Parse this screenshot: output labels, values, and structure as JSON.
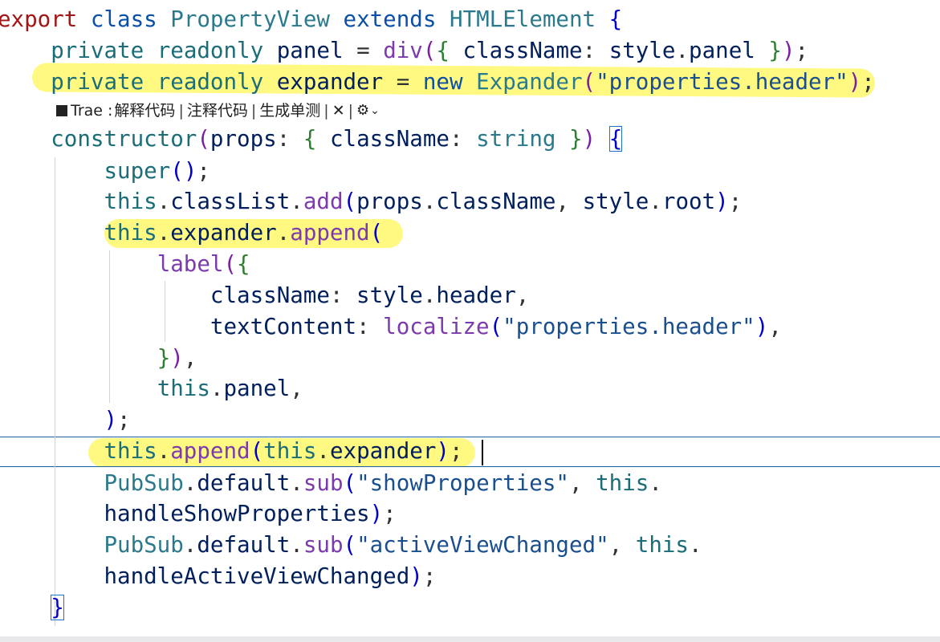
{
  "codelens": {
    "brand": "Trae",
    "actions": [
      "解释代码",
      "注释代码",
      "生成单测"
    ],
    "separator": "|",
    "close_glyph": "✕",
    "settings_icon": "gear-icon",
    "chevron_icon": "chevron-down-icon"
  },
  "code": [
    {
      "tokens": [
        {
          "t": "export",
          "c": "k-red"
        },
        {
          "t": " "
        },
        {
          "t": "class",
          "c": "k-blue"
        },
        {
          "t": " "
        },
        {
          "t": "PropertyView",
          "c": "k-type"
        },
        {
          "t": " "
        },
        {
          "t": "extends",
          "c": "k-blue"
        },
        {
          "t": " "
        },
        {
          "t": "HTMLElement",
          "c": "k-type"
        },
        {
          "t": " "
        },
        {
          "t": "{",
          "c": "k-br1"
        }
      ]
    },
    {
      "tokens": [
        {
          "t": "    "
        },
        {
          "t": "private",
          "c": "k-teal"
        },
        {
          "t": " "
        },
        {
          "t": "readonly",
          "c": "k-teal"
        },
        {
          "t": " "
        },
        {
          "t": "panel",
          "c": "k-id"
        },
        {
          "t": " = ",
          "c": "k-p"
        },
        {
          "t": "div",
          "c": "k-fn"
        },
        {
          "t": "(",
          "c": "k-br2"
        },
        {
          "t": "{",
          "c": "k-br3"
        },
        {
          "t": " "
        },
        {
          "t": "className",
          "c": "k-id"
        },
        {
          "t": ": ",
          "c": "k-p"
        },
        {
          "t": "style",
          "c": "k-id"
        },
        {
          "t": ".",
          "c": "k-p"
        },
        {
          "t": "panel",
          "c": "k-id"
        },
        {
          "t": " "
        },
        {
          "t": "}",
          "c": "k-br3"
        },
        {
          "t": ")",
          "c": "k-br2"
        },
        {
          "t": ";",
          "c": "k-p"
        }
      ]
    },
    {
      "tokens": [
        {
          "t": "    "
        },
        {
          "t": "private",
          "c": "k-teal"
        },
        {
          "t": " "
        },
        {
          "t": "readonly",
          "c": "k-teal"
        },
        {
          "t": " "
        },
        {
          "t": "expander",
          "c": "k-id"
        },
        {
          "t": " = ",
          "c": "k-p"
        },
        {
          "t": "new",
          "c": "k-blue"
        },
        {
          "t": " "
        },
        {
          "t": "Expander",
          "c": "k-type"
        },
        {
          "t": "(",
          "c": "k-br2"
        },
        {
          "t": "\"properties.header\"",
          "c": "k-str"
        },
        {
          "t": ")",
          "c": "k-br2"
        },
        {
          "t": ";",
          "c": "k-p"
        }
      ]
    },
    {
      "tokens": [
        {
          "t": "    "
        },
        {
          "t": "constructor",
          "c": "k-teal"
        },
        {
          "t": "(",
          "c": "k-br2"
        },
        {
          "t": "props",
          "c": "k-id"
        },
        {
          "t": ": ",
          "c": "k-p"
        },
        {
          "t": "{",
          "c": "k-br3"
        },
        {
          "t": " "
        },
        {
          "t": "className",
          "c": "k-id"
        },
        {
          "t": ": ",
          "c": "k-p"
        },
        {
          "t": "string",
          "c": "k-type"
        },
        {
          "t": " "
        },
        {
          "t": "}",
          "c": "k-br3"
        },
        {
          "t": ")",
          "c": "k-br2"
        },
        {
          "t": " "
        },
        {
          "t": "{",
          "c": "k-br1"
        }
      ]
    },
    {
      "tokens": [
        {
          "t": "        "
        },
        {
          "t": "super",
          "c": "k-teal"
        },
        {
          "t": "(",
          "c": "k-br1"
        },
        {
          "t": ")",
          "c": "k-br1"
        },
        {
          "t": ";",
          "c": "k-p"
        }
      ]
    },
    {
      "tokens": [
        {
          "t": "        "
        },
        {
          "t": "this",
          "c": "k-teal"
        },
        {
          "t": ".",
          "c": "k-p"
        },
        {
          "t": "classList",
          "c": "k-id"
        },
        {
          "t": ".",
          "c": "k-p"
        },
        {
          "t": "add",
          "c": "k-fn"
        },
        {
          "t": "(",
          "c": "k-br1"
        },
        {
          "t": "props",
          "c": "k-id"
        },
        {
          "t": ".",
          "c": "k-p"
        },
        {
          "t": "className",
          "c": "k-id"
        },
        {
          "t": ", ",
          "c": "k-p"
        },
        {
          "t": "style",
          "c": "k-id"
        },
        {
          "t": ".",
          "c": "k-p"
        },
        {
          "t": "root",
          "c": "k-id"
        },
        {
          "t": ")",
          "c": "k-br1"
        },
        {
          "t": ";",
          "c": "k-p"
        }
      ]
    },
    {
      "tokens": [
        {
          "t": "        "
        },
        {
          "t": "this",
          "c": "k-teal"
        },
        {
          "t": ".",
          "c": "k-p"
        },
        {
          "t": "expander",
          "c": "k-id"
        },
        {
          "t": ".",
          "c": "k-p"
        },
        {
          "t": "append",
          "c": "k-fn"
        },
        {
          "t": "(",
          "c": "k-br1"
        }
      ]
    },
    {
      "tokens": [
        {
          "t": "            "
        },
        {
          "t": "label",
          "c": "k-fn"
        },
        {
          "t": "(",
          "c": "k-br2"
        },
        {
          "t": "{",
          "c": "k-br3"
        }
      ]
    },
    {
      "tokens": [
        {
          "t": "                "
        },
        {
          "t": "className",
          "c": "k-id"
        },
        {
          "t": ": ",
          "c": "k-p"
        },
        {
          "t": "style",
          "c": "k-id"
        },
        {
          "t": ".",
          "c": "k-p"
        },
        {
          "t": "header",
          "c": "k-id"
        },
        {
          "t": ",",
          "c": "k-p"
        }
      ]
    },
    {
      "tokens": [
        {
          "t": "                "
        },
        {
          "t": "textContent",
          "c": "k-id"
        },
        {
          "t": ": ",
          "c": "k-p"
        },
        {
          "t": "localize",
          "c": "k-fn"
        },
        {
          "t": "(",
          "c": "k-br1"
        },
        {
          "t": "\"properties.header\"",
          "c": "k-str"
        },
        {
          "t": ")",
          "c": "k-br1"
        },
        {
          "t": ",",
          "c": "k-p"
        }
      ]
    },
    {
      "tokens": [
        {
          "t": "            "
        },
        {
          "t": "}",
          "c": "k-br3"
        },
        {
          "t": ")",
          "c": "k-br2"
        },
        {
          "t": ",",
          "c": "k-p"
        }
      ]
    },
    {
      "tokens": [
        {
          "t": "            "
        },
        {
          "t": "this",
          "c": "k-teal"
        },
        {
          "t": ".",
          "c": "k-p"
        },
        {
          "t": "panel",
          "c": "k-id"
        },
        {
          "t": ",",
          "c": "k-p"
        }
      ]
    },
    {
      "tokens": [
        {
          "t": "        "
        },
        {
          "t": ")",
          "c": "k-br1"
        },
        {
          "t": ";",
          "c": "k-p"
        }
      ]
    },
    {
      "tokens": [
        {
          "t": "        "
        },
        {
          "t": "this",
          "c": "k-teal"
        },
        {
          "t": ".",
          "c": "k-p"
        },
        {
          "t": "append",
          "c": "k-fn"
        },
        {
          "t": "(",
          "c": "k-br1"
        },
        {
          "t": "this",
          "c": "k-teal"
        },
        {
          "t": ".",
          "c": "k-p"
        },
        {
          "t": "expander",
          "c": "k-id"
        },
        {
          "t": ")",
          "c": "k-br1"
        },
        {
          "t": ";",
          "c": "k-p"
        }
      ]
    },
    {
      "tokens": [
        {
          "t": "        "
        },
        {
          "t": "PubSub",
          "c": "k-type"
        },
        {
          "t": ".",
          "c": "k-p"
        },
        {
          "t": "default",
          "c": "k-id"
        },
        {
          "t": ".",
          "c": "k-p"
        },
        {
          "t": "sub",
          "c": "k-fn"
        },
        {
          "t": "(",
          "c": "k-br1"
        },
        {
          "t": "\"showProperties\"",
          "c": "k-str"
        },
        {
          "t": ", ",
          "c": "k-p"
        },
        {
          "t": "this",
          "c": "k-teal"
        },
        {
          "t": ".",
          "c": "k-p"
        }
      ]
    },
    {
      "tokens": [
        {
          "t": "        "
        },
        {
          "t": "handleShowProperties",
          "c": "k-id"
        },
        {
          "t": ")",
          "c": "k-br1"
        },
        {
          "t": ";",
          "c": "k-p"
        }
      ]
    },
    {
      "tokens": [
        {
          "t": "        "
        },
        {
          "t": "PubSub",
          "c": "k-type"
        },
        {
          "t": ".",
          "c": "k-p"
        },
        {
          "t": "default",
          "c": "k-id"
        },
        {
          "t": ".",
          "c": "k-p"
        },
        {
          "t": "sub",
          "c": "k-fn"
        },
        {
          "t": "(",
          "c": "k-br1"
        },
        {
          "t": "\"activeViewChanged\"",
          "c": "k-str"
        },
        {
          "t": ", ",
          "c": "k-p"
        },
        {
          "t": "this",
          "c": "k-teal"
        },
        {
          "t": ".",
          "c": "k-p"
        }
      ]
    },
    {
      "tokens": [
        {
          "t": "        "
        },
        {
          "t": "handleActiveViewChanged",
          "c": "k-id"
        },
        {
          "t": ")",
          "c": "k-br1"
        },
        {
          "t": ";",
          "c": "k-p"
        }
      ]
    },
    {
      "tokens": [
        {
          "t": "    "
        },
        {
          "t": "}",
          "c": "k-br1"
        }
      ]
    }
  ]
}
